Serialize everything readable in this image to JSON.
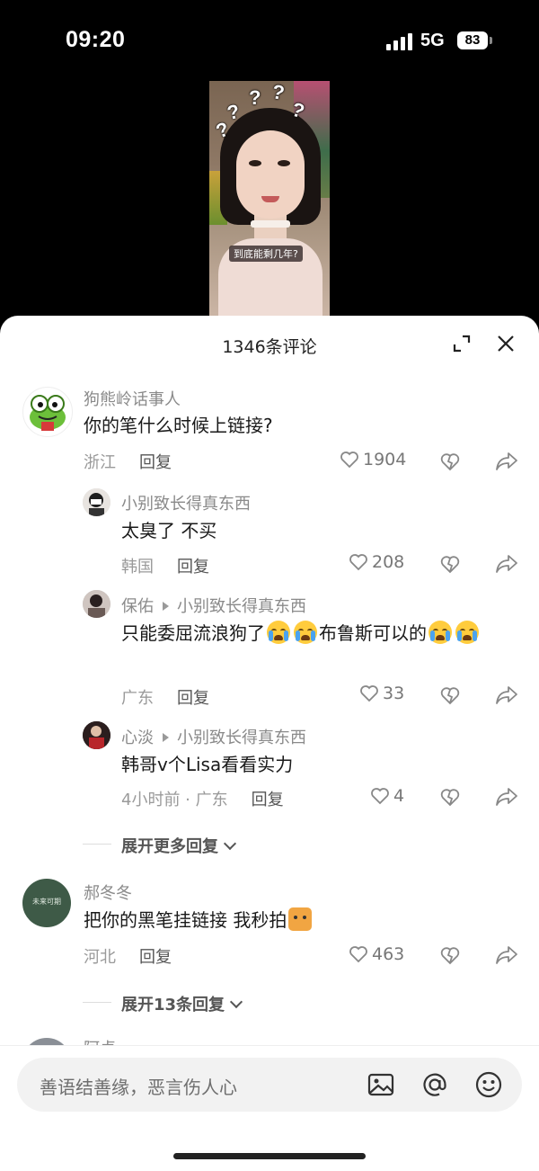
{
  "status_bar": {
    "time": "09:20",
    "network": "5G",
    "battery": "83"
  },
  "video": {
    "question_marks": [
      "?",
      "?",
      "?",
      "?",
      "?"
    ],
    "caption": "到底能剩几年?"
  },
  "sheet": {
    "title": "1346条评论"
  },
  "comments": [
    {
      "author": "狗熊岭话事人",
      "text": "你的笔什么时候上链接?",
      "location": "浙江",
      "reply_label": "回复",
      "likes": "1904",
      "replies": [
        {
          "author": "小别致长得真东西",
          "reply_to": "",
          "text": "太臭了 不买",
          "meta": "韩国",
          "reply_label": "回复",
          "likes": "208"
        },
        {
          "author": "保佑",
          "reply_to": "小别致长得真东西",
          "text": "只能委屈流浪狗了",
          "text_suffix": "布鲁斯可以的",
          "meta": "广东",
          "reply_label": "回复",
          "likes": "33"
        },
        {
          "author": "心淡",
          "reply_to": "小别致长得真东西",
          "text": "韩哥v个Lisa看看实力",
          "meta": "4小时前 · 广东",
          "reply_label": "回复",
          "likes": "4"
        }
      ],
      "expand_label": "展开更多回复"
    },
    {
      "author": "郝冬冬",
      "avatar_text": "未来可期",
      "text": "把你的黑笔挂链接 我秒拍",
      "location": "河北",
      "reply_label": "回复",
      "likes": "463",
      "expand_label": "展开13条回复"
    },
    {
      "author": "阿卓"
    }
  ],
  "input": {
    "placeholder": "善语结善缘，恶言伤人心"
  },
  "icons": [
    "image-icon",
    "at-icon",
    "emoji-icon",
    "expand-icon",
    "close-icon",
    "heart-icon",
    "dislike-icon",
    "share-icon"
  ]
}
